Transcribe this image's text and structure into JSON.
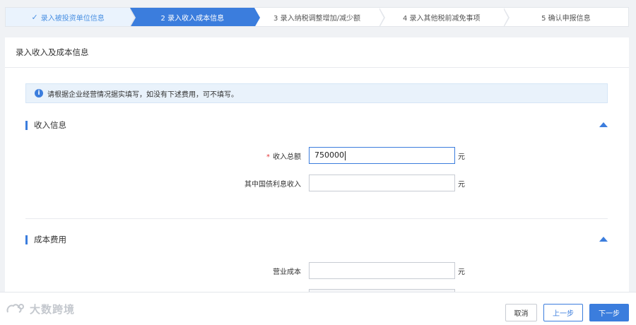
{
  "steps": [
    {
      "label": "录入被投资单位信息",
      "state": "done",
      "icon": "check-icon"
    },
    {
      "label": "2 录入收入成本信息",
      "state": "active"
    },
    {
      "label": "3 录入纳税调整增加/减少额",
      "state": "pending"
    },
    {
      "label": "4 录入其他税前减免事项",
      "state": "pending"
    },
    {
      "label": "5 确认申报信息",
      "state": "pending"
    }
  ],
  "card": {
    "title": "录入收入及成本信息"
  },
  "notice": {
    "icon": "info-icon",
    "text": "请根据企业经营情况据实填写，如没有下述费用，可不填写。"
  },
  "income_section": {
    "title": "收入信息",
    "toggle_icon": "collapse-up-icon",
    "fields": [
      {
        "label": "收入总额",
        "required": "*",
        "value": "750000",
        "unit": "元"
      },
      {
        "label": "其中国债利息收入",
        "value": "",
        "unit": "元"
      }
    ]
  },
  "cost_section": {
    "title": "成本费用",
    "toggle_icon": "collapse-up-icon",
    "fields": [
      {
        "label": "营业成本",
        "value": "",
        "unit": "元"
      }
    ]
  },
  "footer": {
    "brand": "大数跨境",
    "cancel_label": "取消",
    "prev_label": "上一步",
    "next_label": "下一步"
  },
  "colors": {
    "accent": "#3b7ddd",
    "done_bg": "#eaf3fd",
    "required": "#e4393c",
    "notice_bg": "#e9f2fb"
  }
}
